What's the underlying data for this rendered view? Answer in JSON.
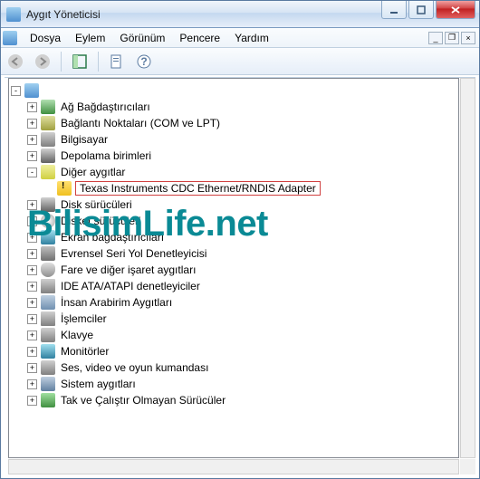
{
  "window": {
    "title": "Aygıt Yöneticisi"
  },
  "menu": {
    "file": "Dosya",
    "action": "Eylem",
    "view": "Görünüm",
    "window": "Pencere",
    "help": "Yardım"
  },
  "tree": {
    "root_expander": "-",
    "items": [
      {
        "exp": "+",
        "icon": "ic-net",
        "label": "Ağ Bağdaştırıcıları"
      },
      {
        "exp": "+",
        "icon": "ic-port",
        "label": "Bağlantı Noktaları (COM ve LPT)"
      },
      {
        "exp": "+",
        "icon": "ic-pc",
        "label": "Bilgisayar"
      },
      {
        "exp": "+",
        "icon": "ic-disk",
        "label": "Depolama birimleri"
      },
      {
        "exp": "-",
        "icon": "ic-other",
        "label": "Diğer aygıtlar",
        "children": [
          {
            "icon": "ic-warn",
            "label": "Texas Instruments CDC Ethernet/RNDIS Adapter",
            "selected": true
          }
        ]
      },
      {
        "exp": "+",
        "icon": "ic-disk",
        "label": "Disk sürücüleri"
      },
      {
        "exp": "+",
        "icon": "ic-cd",
        "label": "Disket sürücüleri"
      },
      {
        "exp": "+",
        "icon": "ic-mon",
        "label": "Ekran bağdaştırıcıları"
      },
      {
        "exp": "+",
        "icon": "ic-usb",
        "label": "Evrensel Seri Yol Denetleyicisi"
      },
      {
        "exp": "+",
        "icon": "ic-mouse",
        "label": "Fare ve diğer işaret aygıtları"
      },
      {
        "exp": "+",
        "icon": "ic-ide",
        "label": "IDE ATA/ATAPI denetleyiciler"
      },
      {
        "exp": "+",
        "icon": "ic-hid",
        "label": "İnsan Arabirim Aygıtları"
      },
      {
        "exp": "+",
        "icon": "ic-cpu",
        "label": "İşlemciler"
      },
      {
        "exp": "+",
        "icon": "ic-kbd",
        "label": "Klavye"
      },
      {
        "exp": "+",
        "icon": "ic-mon",
        "label": "Monitörler"
      },
      {
        "exp": "+",
        "icon": "ic-snd",
        "label": "Ses, video ve oyun kumandası"
      },
      {
        "exp": "+",
        "icon": "ic-sys",
        "label": "Sistem aygıtları"
      },
      {
        "exp": "+",
        "icon": "ic-plug",
        "label": "Tak ve Çalıştır Olmayan Sürücüler"
      }
    ]
  },
  "watermark": "BilisimLife.net"
}
